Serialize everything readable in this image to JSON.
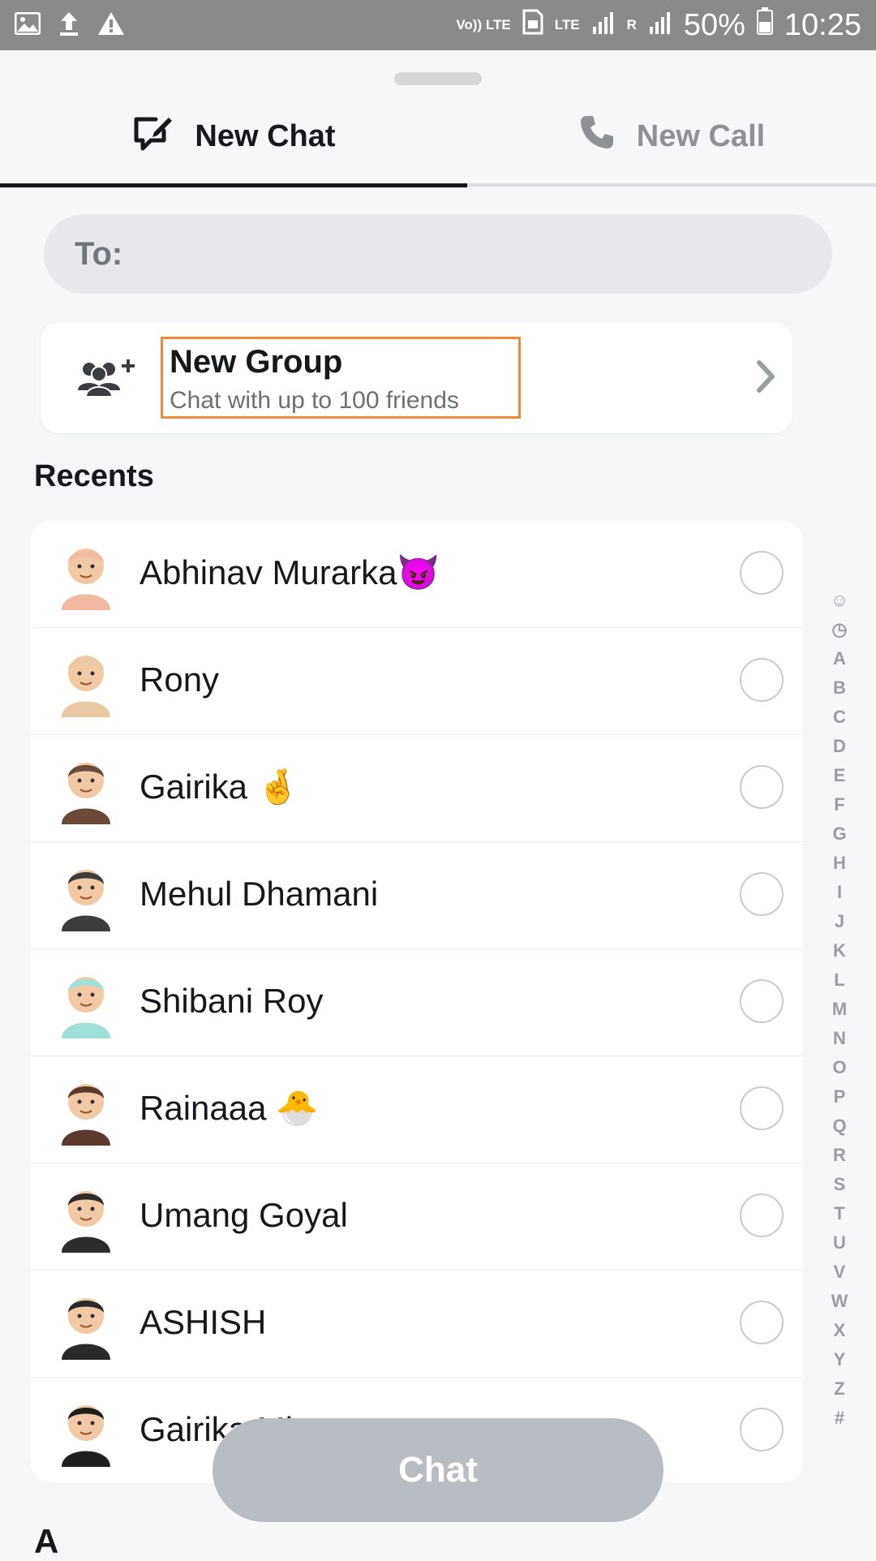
{
  "status_bar": {
    "left_icons": [
      "image-icon",
      "upload-icon",
      "warning-icon"
    ],
    "volte": "Vo)) LTE",
    "lte": "LTE",
    "roaming": "R",
    "battery": "50%",
    "time": "10:25"
  },
  "tabs": [
    {
      "label": "New Chat",
      "icon": "new-chat-icon",
      "active": true
    },
    {
      "label": "New Call",
      "icon": "phone-icon",
      "active": false
    }
  ],
  "to_field": {
    "label": "To:",
    "value": "",
    "placeholder": ""
  },
  "new_group": {
    "title": "New Group",
    "subtitle": "Chat with up to 100 friends",
    "icon": "add-group-icon"
  },
  "recents_heading": "Recents",
  "contacts": [
    {
      "name": "Abhinav Murarka😈",
      "selected": false,
      "avatar_color": "#f2b8a0"
    },
    {
      "name": "Rony",
      "selected": false,
      "avatar_color": "#e9c9a4"
    },
    {
      "name": "Gairika 🤞",
      "selected": false,
      "avatar_color": "#6a4a3a"
    },
    {
      "name": "Mehul Dhamani",
      "selected": false,
      "avatar_color": "#3d3d3d"
    },
    {
      "name": "Shibani Roy",
      "selected": false,
      "avatar_color": "#9fe1d8"
    },
    {
      "name": "Rainaaa 🐣",
      "selected": false,
      "avatar_color": "#5a3a2e"
    },
    {
      "name": "Umang Goyal",
      "selected": false,
      "avatar_color": "#2c2c2c"
    },
    {
      "name": "ASHISH",
      "selected": false,
      "avatar_color": "#2a2a2a"
    },
    {
      "name": "Gairika Mi",
      "selected": false,
      "avatar_color": "#1f1f1f"
    }
  ],
  "alpha_index": [
    "☺",
    "◷",
    "A",
    "B",
    "C",
    "D",
    "E",
    "F",
    "G",
    "H",
    "I",
    "J",
    "K",
    "L",
    "M",
    "N",
    "O",
    "P",
    "Q",
    "R",
    "S",
    "T",
    "U",
    "V",
    "W",
    "X",
    "Y",
    "Z",
    "#"
  ],
  "chat_button": "Chat",
  "section_letter": "A",
  "colors": {
    "accent_border": "#f0883a",
    "chat_button_disabled": "#b8bdc4"
  }
}
